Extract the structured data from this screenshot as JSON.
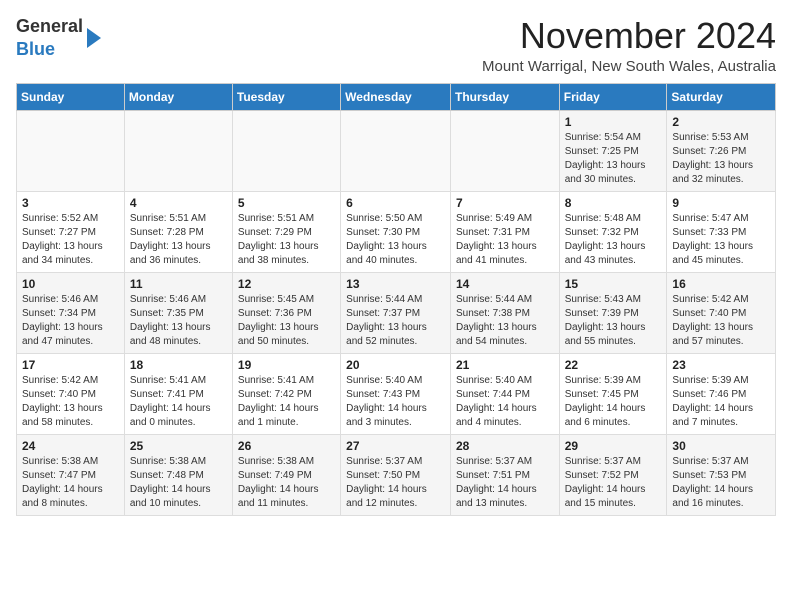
{
  "header": {
    "logo_general": "General",
    "logo_blue": "Blue",
    "month_title": "November 2024",
    "location": "Mount Warrigal, New South Wales, Australia"
  },
  "weekdays": [
    "Sunday",
    "Monday",
    "Tuesday",
    "Wednesday",
    "Thursday",
    "Friday",
    "Saturday"
  ],
  "weeks": [
    [
      {
        "day": "",
        "info": ""
      },
      {
        "day": "",
        "info": ""
      },
      {
        "day": "",
        "info": ""
      },
      {
        "day": "",
        "info": ""
      },
      {
        "day": "",
        "info": ""
      },
      {
        "day": "1",
        "info": "Sunrise: 5:54 AM\nSunset: 7:25 PM\nDaylight: 13 hours\nand 30 minutes."
      },
      {
        "day": "2",
        "info": "Sunrise: 5:53 AM\nSunset: 7:26 PM\nDaylight: 13 hours\nand 32 minutes."
      }
    ],
    [
      {
        "day": "3",
        "info": "Sunrise: 5:52 AM\nSunset: 7:27 PM\nDaylight: 13 hours\nand 34 minutes."
      },
      {
        "day": "4",
        "info": "Sunrise: 5:51 AM\nSunset: 7:28 PM\nDaylight: 13 hours\nand 36 minutes."
      },
      {
        "day": "5",
        "info": "Sunrise: 5:51 AM\nSunset: 7:29 PM\nDaylight: 13 hours\nand 38 minutes."
      },
      {
        "day": "6",
        "info": "Sunrise: 5:50 AM\nSunset: 7:30 PM\nDaylight: 13 hours\nand 40 minutes."
      },
      {
        "day": "7",
        "info": "Sunrise: 5:49 AM\nSunset: 7:31 PM\nDaylight: 13 hours\nand 41 minutes."
      },
      {
        "day": "8",
        "info": "Sunrise: 5:48 AM\nSunset: 7:32 PM\nDaylight: 13 hours\nand 43 minutes."
      },
      {
        "day": "9",
        "info": "Sunrise: 5:47 AM\nSunset: 7:33 PM\nDaylight: 13 hours\nand 45 minutes."
      }
    ],
    [
      {
        "day": "10",
        "info": "Sunrise: 5:46 AM\nSunset: 7:34 PM\nDaylight: 13 hours\nand 47 minutes."
      },
      {
        "day": "11",
        "info": "Sunrise: 5:46 AM\nSunset: 7:35 PM\nDaylight: 13 hours\nand 48 minutes."
      },
      {
        "day": "12",
        "info": "Sunrise: 5:45 AM\nSunset: 7:36 PM\nDaylight: 13 hours\nand 50 minutes."
      },
      {
        "day": "13",
        "info": "Sunrise: 5:44 AM\nSunset: 7:37 PM\nDaylight: 13 hours\nand 52 minutes."
      },
      {
        "day": "14",
        "info": "Sunrise: 5:44 AM\nSunset: 7:38 PM\nDaylight: 13 hours\nand 54 minutes."
      },
      {
        "day": "15",
        "info": "Sunrise: 5:43 AM\nSunset: 7:39 PM\nDaylight: 13 hours\nand 55 minutes."
      },
      {
        "day": "16",
        "info": "Sunrise: 5:42 AM\nSunset: 7:40 PM\nDaylight: 13 hours\nand 57 minutes."
      }
    ],
    [
      {
        "day": "17",
        "info": "Sunrise: 5:42 AM\nSunset: 7:40 PM\nDaylight: 13 hours\nand 58 minutes."
      },
      {
        "day": "18",
        "info": "Sunrise: 5:41 AM\nSunset: 7:41 PM\nDaylight: 14 hours\nand 0 minutes."
      },
      {
        "day": "19",
        "info": "Sunrise: 5:41 AM\nSunset: 7:42 PM\nDaylight: 14 hours\nand 1 minute."
      },
      {
        "day": "20",
        "info": "Sunrise: 5:40 AM\nSunset: 7:43 PM\nDaylight: 14 hours\nand 3 minutes."
      },
      {
        "day": "21",
        "info": "Sunrise: 5:40 AM\nSunset: 7:44 PM\nDaylight: 14 hours\nand 4 minutes."
      },
      {
        "day": "22",
        "info": "Sunrise: 5:39 AM\nSunset: 7:45 PM\nDaylight: 14 hours\nand 6 minutes."
      },
      {
        "day": "23",
        "info": "Sunrise: 5:39 AM\nSunset: 7:46 PM\nDaylight: 14 hours\nand 7 minutes."
      }
    ],
    [
      {
        "day": "24",
        "info": "Sunrise: 5:38 AM\nSunset: 7:47 PM\nDaylight: 14 hours\nand 8 minutes."
      },
      {
        "day": "25",
        "info": "Sunrise: 5:38 AM\nSunset: 7:48 PM\nDaylight: 14 hours\nand 10 minutes."
      },
      {
        "day": "26",
        "info": "Sunrise: 5:38 AM\nSunset: 7:49 PM\nDaylight: 14 hours\nand 11 minutes."
      },
      {
        "day": "27",
        "info": "Sunrise: 5:37 AM\nSunset: 7:50 PM\nDaylight: 14 hours\nand 12 minutes."
      },
      {
        "day": "28",
        "info": "Sunrise: 5:37 AM\nSunset: 7:51 PM\nDaylight: 14 hours\nand 13 minutes."
      },
      {
        "day": "29",
        "info": "Sunrise: 5:37 AM\nSunset: 7:52 PM\nDaylight: 14 hours\nand 15 minutes."
      },
      {
        "day": "30",
        "info": "Sunrise: 5:37 AM\nSunset: 7:53 PM\nDaylight: 14 hours\nand 16 minutes."
      }
    ]
  ]
}
